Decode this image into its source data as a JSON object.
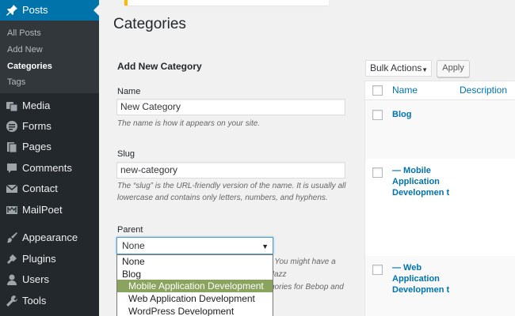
{
  "sidebar": {
    "posts_label": "Posts",
    "submenu": [
      "All Posts",
      "Add New",
      "Categories",
      "Tags"
    ],
    "items": [
      {
        "label": "Media",
        "icon": "media-icon"
      },
      {
        "label": "Forms",
        "icon": "forms-icon"
      },
      {
        "label": "Pages",
        "icon": "pages-icon"
      },
      {
        "label": "Comments",
        "icon": "comments-icon"
      },
      {
        "label": "Contact",
        "icon": "contact-icon"
      },
      {
        "label": "MailPoet",
        "icon": "mailpoet-icon"
      },
      {
        "label": "Appearance",
        "icon": "appearance-icon"
      },
      {
        "label": "Plugins",
        "icon": "plugins-icon"
      },
      {
        "label": "Users",
        "icon": "users-icon"
      },
      {
        "label": "Tools",
        "icon": "tools-icon"
      }
    ]
  },
  "page": {
    "title": "Categories"
  },
  "form": {
    "heading": "Add New Category",
    "name_label": "Name",
    "name_value": "New Category",
    "name_help": "The name is how it appears on your site.",
    "slug_label": "Slug",
    "slug_value": "new-category",
    "slug_help": "The “slug” is the URL-friendly version of the name. It is usually all lowercase and contains only letters, numbers, and hyphens.",
    "parent_label": "Parent",
    "parent_value": "None",
    "parent_help_line1": ". You might have a Jazz",
    "parent_help_line2": "gories for Bebop and",
    "parent_options": [
      "None",
      "Blog",
      "Mobile Application Development",
      "Web Application Development",
      "WordPress Development"
    ],
    "parent_highlighted": "Mobile Application Development"
  },
  "table": {
    "bulk_actions": "Bulk Actions",
    "apply": "Apply",
    "columns": [
      "Name",
      "Description"
    ],
    "rows": [
      {
        "name": "Blog"
      },
      {
        "name": "— Mobile Application Developmen t"
      },
      {
        "name": "— Web Application Developmen t"
      }
    ]
  },
  "colors": {
    "sidebar": "#23282d",
    "active": "#0073aa",
    "submenu": "#32373c",
    "link": "#0073aa",
    "highlight": "#8aa45f",
    "notice": "#ffb900"
  }
}
